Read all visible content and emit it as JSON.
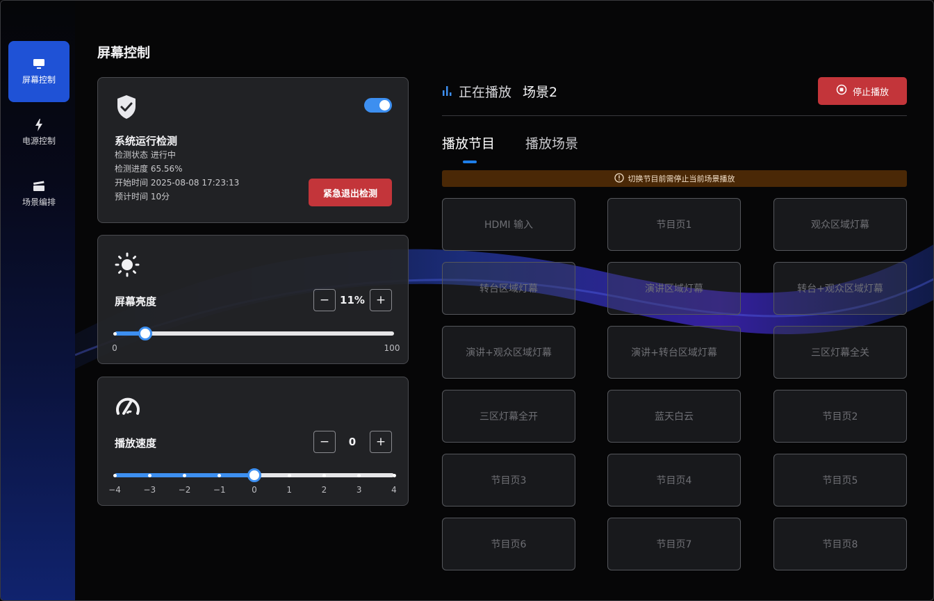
{
  "sidebar": {
    "items": [
      {
        "label": "屏幕控制",
        "icon": "monitor-icon",
        "active": true
      },
      {
        "label": "电源控制",
        "icon": "lightning-icon",
        "active": false
      },
      {
        "label": "场景编排",
        "icon": "clapperboard-icon",
        "active": false
      }
    ]
  },
  "page": {
    "title": "屏幕控制"
  },
  "system_check": {
    "icon": "shield-check-icon",
    "title": "系统运行检测",
    "toggle_on": true,
    "status": "检测状态 进行中",
    "progress": "检测进度 65.56%",
    "start_time": "开始时间 2025-08-08 17:23:13",
    "eta": "预计时间 10分",
    "exit_label": "紧急退出检测"
  },
  "brightness": {
    "icon": "sun-icon",
    "title": "屏幕亮度",
    "value_text": "11%",
    "value": 11,
    "min_label": "0",
    "max_label": "100",
    "decrement": "−",
    "increment": "+"
  },
  "speed": {
    "icon": "speedometer-icon",
    "title": "播放速度",
    "value_text": "0",
    "value": 0,
    "decrement": "−",
    "increment": "+",
    "ticks": [
      "−4",
      "−3",
      "−2",
      "−1",
      "0",
      "1",
      "2",
      "3",
      "4"
    ]
  },
  "now_playing": {
    "icon": "bar-chart-icon",
    "label": "正在播放",
    "scene": "场景2",
    "stop_label": "停止播放",
    "stop_icon": "stop-circle-icon"
  },
  "tabs": [
    {
      "label": "播放节目",
      "active": true
    },
    {
      "label": "播放场景",
      "active": false
    }
  ],
  "warning": {
    "icon": "alert-circle-icon",
    "text": "切换节目前需停止当前场景播放"
  },
  "programs": [
    "HDMI 输入",
    "节目页1",
    "观众区域灯幕",
    "转台区域灯幕",
    "演讲区域灯幕",
    "转台+观众区域灯幕",
    "演讲+观众区域灯幕",
    "演讲+转台区域灯幕",
    "三区灯幕全关",
    "三区灯幕全开",
    "蓝天白云",
    "节目页2",
    "节目页3",
    "节目页4",
    "节目页5",
    "节目页6",
    "节目页7",
    "节目页8"
  ],
  "colors": {
    "accent": "#3d8ff0",
    "active_nav": "#1f52d6",
    "danger": "#c3353a",
    "warning_bg": "#4a2806"
  }
}
